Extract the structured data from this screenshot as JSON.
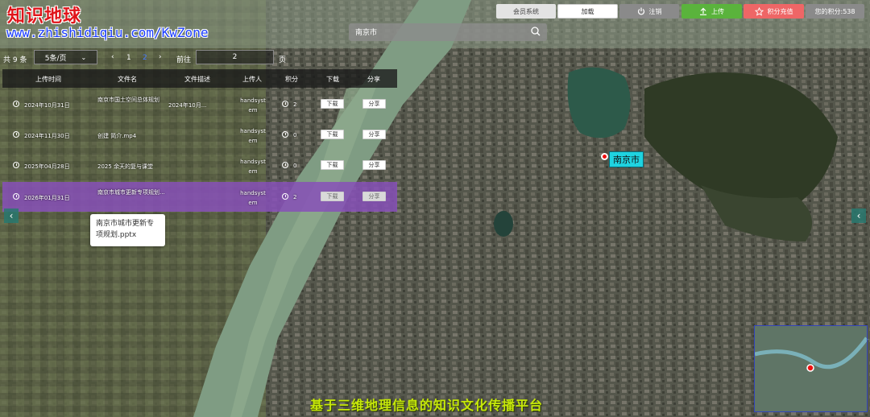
{
  "brand": {
    "title": "知识地球",
    "url": "www.zhishidiqiu.com/KwZone"
  },
  "search": {
    "value": "南京市",
    "icon": "search-icon"
  },
  "topbar": {
    "member": "会员系统",
    "load": "加载",
    "logout": "注销",
    "upload": "上传",
    "recharge": "积分充值",
    "points": "您的积分:538"
  },
  "pager": {
    "total": "共 9 条",
    "page_size": "5条/页",
    "pages": [
      "1",
      "2"
    ],
    "current_page": "2",
    "goto_label": "前往",
    "goto_value": "2",
    "page_unit": "页"
  },
  "table": {
    "headers": [
      "上传时间",
      "文件名",
      "文件描述",
      "上传人",
      "积分",
      "下载",
      "分享"
    ],
    "rows": [
      {
        "time": "2024年10月31日",
        "name": "南京市国土空间总体规划",
        "desc": "2024年10月...",
        "uploader": "handsystem",
        "points": "2",
        "download": "下载",
        "share": "分享"
      },
      {
        "time": "2024年11月30日",
        "name": "创建 简介.mp4",
        "desc": "",
        "uploader": "handsystem",
        "points": "0",
        "download": "下载",
        "share": "分享"
      },
      {
        "time": "2025年04月28日",
        "name": "2025 余天的复与课堂",
        "desc": "",
        "uploader": "handsystem",
        "points": "0",
        "download": "下载",
        "share": "分享"
      },
      {
        "time": "2026年01月31日",
        "name": "南京市城市更新专项规划...",
        "desc": "",
        "uploader": "handsystem",
        "points": "2",
        "download": "下载",
        "share": "分享"
      }
    ]
  },
  "tooltip": {
    "text": "南京市城市更新专项规划.pptx"
  },
  "map": {
    "city_label": "南京市"
  },
  "footer": {
    "slogan": "基于三维地理信息的知识文化传播平台"
  },
  "colors": {
    "upload": "#5ab33c",
    "recharge": "#ee6666",
    "active_row": "#8750b9",
    "city_label": "#1fd3e0",
    "footer": "#c6e80a"
  }
}
